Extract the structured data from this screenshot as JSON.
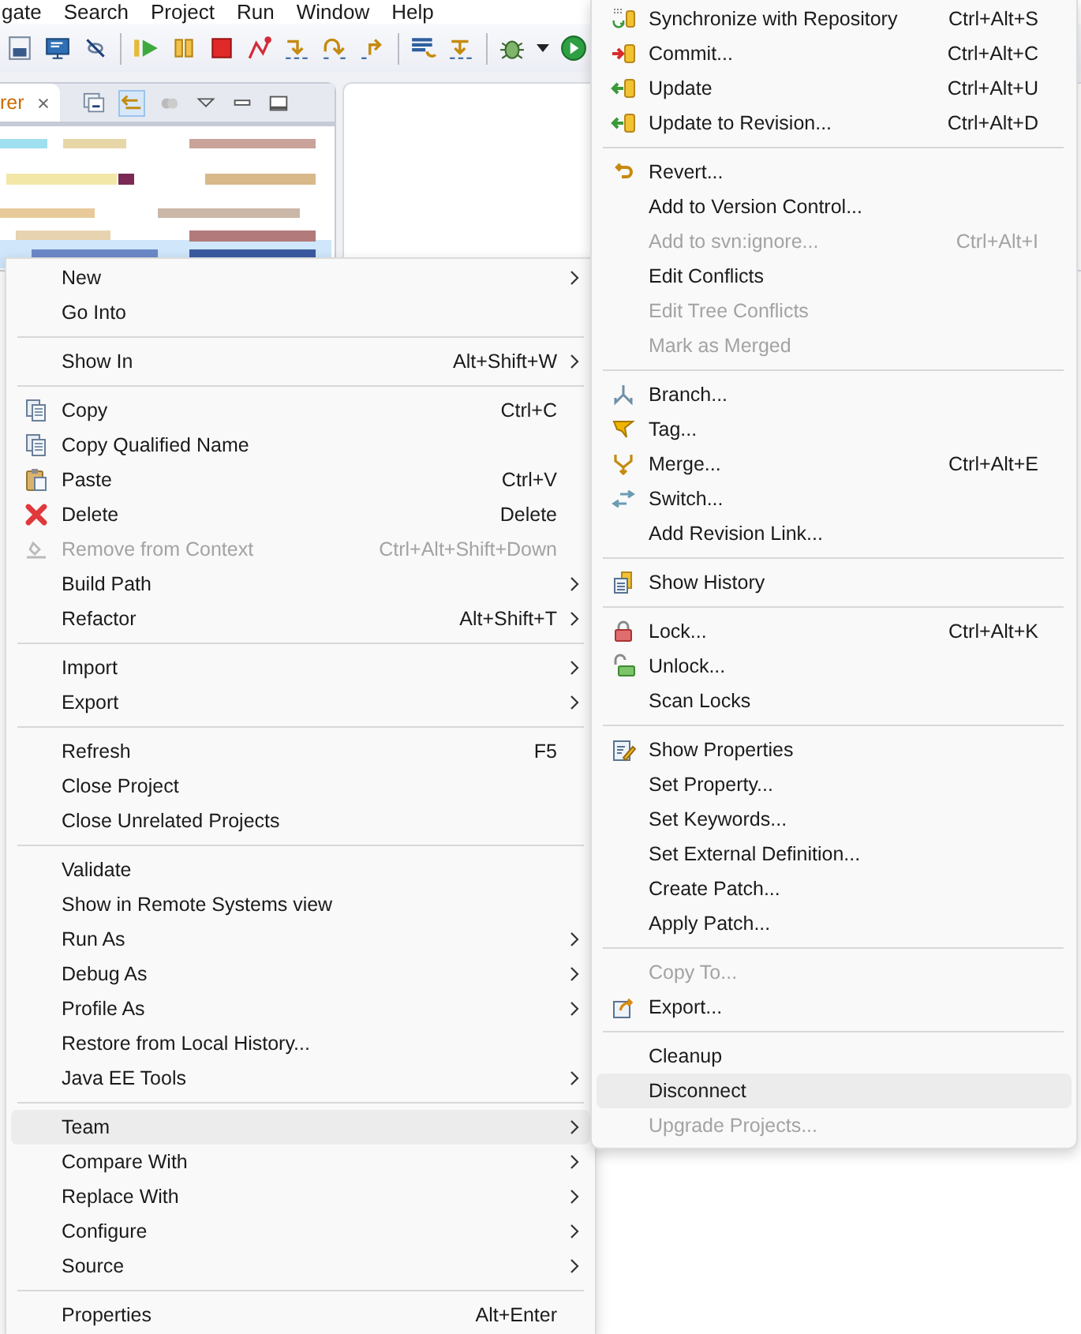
{
  "menubar": [
    "gate",
    "Search",
    "Project",
    "Run",
    "Window",
    "Help"
  ],
  "explorer_tab": {
    "label": "rer"
  },
  "context_menu": {
    "items": [
      {
        "kind": "item",
        "label": "New",
        "submenu": true,
        "disabled": false,
        "selected": false
      },
      {
        "kind": "item",
        "label": "Go Into",
        "submenu": false,
        "disabled": false,
        "selected": false
      },
      {
        "kind": "separator"
      },
      {
        "kind": "item",
        "label": "Show In",
        "shortcut": "Alt+Shift+W",
        "submenu": true,
        "disabled": false,
        "selected": false
      },
      {
        "kind": "separator"
      },
      {
        "kind": "item",
        "label": "Copy",
        "shortcut": "Ctrl+C",
        "submenu": false,
        "disabled": false,
        "selected": false
      },
      {
        "kind": "item",
        "label": "Copy Qualified Name",
        "submenu": false,
        "disabled": false,
        "selected": false
      },
      {
        "kind": "item",
        "label": "Paste",
        "shortcut": "Ctrl+V",
        "submenu": false,
        "disabled": false,
        "selected": false
      },
      {
        "kind": "item",
        "label": "Delete",
        "shortcut": "Delete",
        "submenu": false,
        "disabled": false,
        "selected": false
      },
      {
        "kind": "item",
        "label": "Remove from Context",
        "shortcut": "Ctrl+Alt+Shift+Down",
        "submenu": false,
        "disabled": true,
        "selected": false
      },
      {
        "kind": "item",
        "label": "Build Path",
        "submenu": true,
        "disabled": false,
        "selected": false
      },
      {
        "kind": "item",
        "label": "Refactor",
        "shortcut": "Alt+Shift+T",
        "submenu": true,
        "disabled": false,
        "selected": false
      },
      {
        "kind": "separator"
      },
      {
        "kind": "item",
        "label": "Import",
        "submenu": true,
        "disabled": false,
        "selected": false
      },
      {
        "kind": "item",
        "label": "Export",
        "submenu": true,
        "disabled": false,
        "selected": false
      },
      {
        "kind": "separator"
      },
      {
        "kind": "item",
        "label": "Refresh",
        "shortcut": "F5",
        "submenu": false,
        "disabled": false,
        "selected": false
      },
      {
        "kind": "item",
        "label": "Close Project",
        "submenu": false,
        "disabled": false,
        "selected": false
      },
      {
        "kind": "item",
        "label": "Close Unrelated Projects",
        "submenu": false,
        "disabled": false,
        "selected": false
      },
      {
        "kind": "separator"
      },
      {
        "kind": "item",
        "label": "Validate",
        "submenu": false,
        "disabled": false,
        "selected": false
      },
      {
        "kind": "item",
        "label": "Show in Remote Systems view",
        "submenu": false,
        "disabled": false,
        "selected": false
      },
      {
        "kind": "item",
        "label": "Run As",
        "submenu": true,
        "disabled": false,
        "selected": false
      },
      {
        "kind": "item",
        "label": "Debug As",
        "submenu": true,
        "disabled": false,
        "selected": false
      },
      {
        "kind": "item",
        "label": "Profile As",
        "submenu": true,
        "disabled": false,
        "selected": false
      },
      {
        "kind": "item",
        "label": "Restore from Local History...",
        "submenu": false,
        "disabled": false,
        "selected": false
      },
      {
        "kind": "item",
        "label": "Java EE Tools",
        "submenu": true,
        "disabled": false,
        "selected": false
      },
      {
        "kind": "separator"
      },
      {
        "kind": "item",
        "label": "Team",
        "submenu": true,
        "disabled": false,
        "selected": true
      },
      {
        "kind": "item",
        "label": "Compare With",
        "submenu": true,
        "disabled": false,
        "selected": false
      },
      {
        "kind": "item",
        "label": "Replace With",
        "submenu": true,
        "disabled": false,
        "selected": false
      },
      {
        "kind": "item",
        "label": "Configure",
        "submenu": true,
        "disabled": false,
        "selected": false
      },
      {
        "kind": "item",
        "label": "Source",
        "submenu": true,
        "disabled": false,
        "selected": false
      },
      {
        "kind": "separator"
      },
      {
        "kind": "item",
        "label": "Properties",
        "shortcut": "Alt+Enter",
        "submenu": false,
        "disabled": false,
        "selected": false
      }
    ]
  },
  "team_submenu": {
    "items": [
      {
        "kind": "item",
        "label": "Synchronize with Repository",
        "shortcut": "Ctrl+Alt+S",
        "disabled": false,
        "selected": false
      },
      {
        "kind": "item",
        "label": "Commit...",
        "shortcut": "Ctrl+Alt+C",
        "disabled": false,
        "selected": false
      },
      {
        "kind": "item",
        "label": "Update",
        "shortcut": "Ctrl+Alt+U",
        "disabled": false,
        "selected": false
      },
      {
        "kind": "item",
        "label": "Update to Revision...",
        "shortcut": "Ctrl+Alt+D",
        "disabled": false,
        "selected": false
      },
      {
        "kind": "separator"
      },
      {
        "kind": "item",
        "label": "Revert...",
        "disabled": false,
        "selected": false
      },
      {
        "kind": "item",
        "label": "Add to Version Control...",
        "disabled": false,
        "selected": false
      },
      {
        "kind": "item",
        "label": "Add to svn:ignore...",
        "shortcut": "Ctrl+Alt+I",
        "disabled": true,
        "selected": false
      },
      {
        "kind": "item",
        "label": "Edit Conflicts",
        "disabled": false,
        "selected": false
      },
      {
        "kind": "item",
        "label": "Edit Tree Conflicts",
        "disabled": true,
        "selected": false
      },
      {
        "kind": "item",
        "label": "Mark as Merged",
        "disabled": true,
        "selected": false
      },
      {
        "kind": "separator"
      },
      {
        "kind": "item",
        "label": "Branch...",
        "disabled": false,
        "selected": false
      },
      {
        "kind": "item",
        "label": "Tag...",
        "disabled": false,
        "selected": false
      },
      {
        "kind": "item",
        "label": "Merge...",
        "shortcut": "Ctrl+Alt+E",
        "disabled": false,
        "selected": false
      },
      {
        "kind": "item",
        "label": "Switch...",
        "disabled": false,
        "selected": false
      },
      {
        "kind": "item",
        "label": "Add Revision Link...",
        "disabled": false,
        "selected": false
      },
      {
        "kind": "separator"
      },
      {
        "kind": "item",
        "label": "Show History",
        "disabled": false,
        "selected": false
      },
      {
        "kind": "separator"
      },
      {
        "kind": "item",
        "label": "Lock...",
        "shortcut": "Ctrl+Alt+K",
        "disabled": false,
        "selected": false
      },
      {
        "kind": "item",
        "label": "Unlock...",
        "disabled": false,
        "selected": false
      },
      {
        "kind": "item",
        "label": "Scan Locks",
        "disabled": false,
        "selected": false
      },
      {
        "kind": "separator"
      },
      {
        "kind": "item",
        "label": "Show Properties",
        "disabled": false,
        "selected": false
      },
      {
        "kind": "item",
        "label": "Set Property...",
        "disabled": false,
        "selected": false
      },
      {
        "kind": "item",
        "label": "Set Keywords...",
        "disabled": false,
        "selected": false
      },
      {
        "kind": "item",
        "label": "Set External Definition...",
        "disabled": false,
        "selected": false
      },
      {
        "kind": "item",
        "label": "Create Patch...",
        "disabled": false,
        "selected": false
      },
      {
        "kind": "item",
        "label": "Apply Patch...",
        "disabled": false,
        "selected": false
      },
      {
        "kind": "separator"
      },
      {
        "kind": "item",
        "label": "Copy To...",
        "disabled": true,
        "selected": false
      },
      {
        "kind": "item",
        "label": "Export...",
        "disabled": false,
        "selected": false
      },
      {
        "kind": "separator"
      },
      {
        "kind": "item",
        "label": "Cleanup",
        "disabled": false,
        "selected": false
      },
      {
        "kind": "item",
        "label": "Disconnect",
        "disabled": false,
        "selected": true
      },
      {
        "kind": "item",
        "label": "Upgrade Projects...",
        "disabled": true,
        "selected": false
      }
    ]
  }
}
